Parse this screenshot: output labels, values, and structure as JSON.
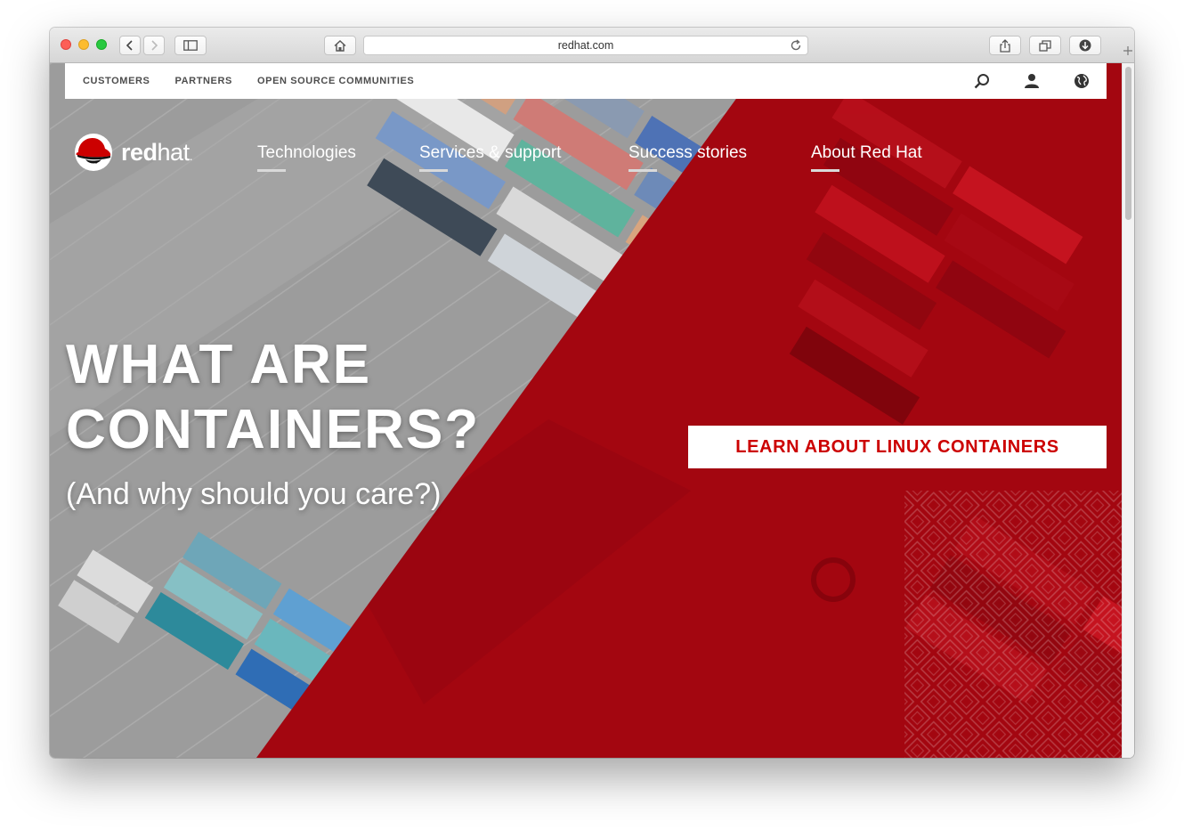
{
  "browser": {
    "url": "redhat.com"
  },
  "utility_nav": {
    "links": [
      "CUSTOMERS",
      "PARTNERS",
      "OPEN SOURCE COMMUNITIES"
    ]
  },
  "brand": {
    "name_bold": "red",
    "name_light": "hat",
    "name_suffix": "."
  },
  "main_nav": {
    "items": [
      "Technologies",
      "Services & support",
      "Success stories",
      "About Red Hat"
    ]
  },
  "hero": {
    "headline_line1": "WHAT ARE",
    "headline_line2": "CONTAINERS?",
    "subheadline": "(And why should you care?)",
    "cta_label": "LEARN ABOUT LINUX CONTAINERS"
  },
  "colors": {
    "brand_red": "#cc0000",
    "hero_red": "#a30610"
  }
}
